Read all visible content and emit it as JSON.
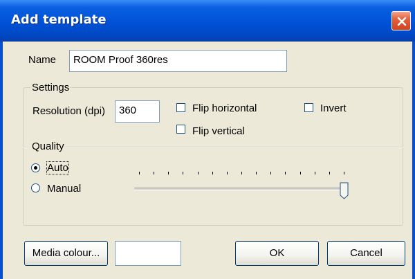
{
  "window": {
    "title": "Add template"
  },
  "name": {
    "label": "Name",
    "value": "ROOM Proof 360res"
  },
  "settings": {
    "legend": "Settings",
    "resolution_label": "Resolution (dpi)",
    "resolution_value": "360",
    "flip_horizontal": {
      "label": "Flip horizontal",
      "checked": false
    },
    "flip_vertical": {
      "label": "Flip vertical",
      "checked": false
    },
    "invert": {
      "label": "Invert",
      "checked": false
    }
  },
  "quality": {
    "legend": "Quality",
    "auto": {
      "label": "Auto",
      "selected": true
    },
    "manual": {
      "label": "Manual",
      "selected": false
    },
    "slider_value_fraction": 1.0,
    "tick_count": 15
  },
  "buttons": {
    "media_colour": "Media colour...",
    "ok": "OK",
    "cancel": "Cancel"
  },
  "colors": {
    "dialog_bg": "#ece9d8",
    "titlebar": "#0051d6",
    "close_button": "#e5603b"
  },
  "icons": {
    "close": "close-icon"
  }
}
